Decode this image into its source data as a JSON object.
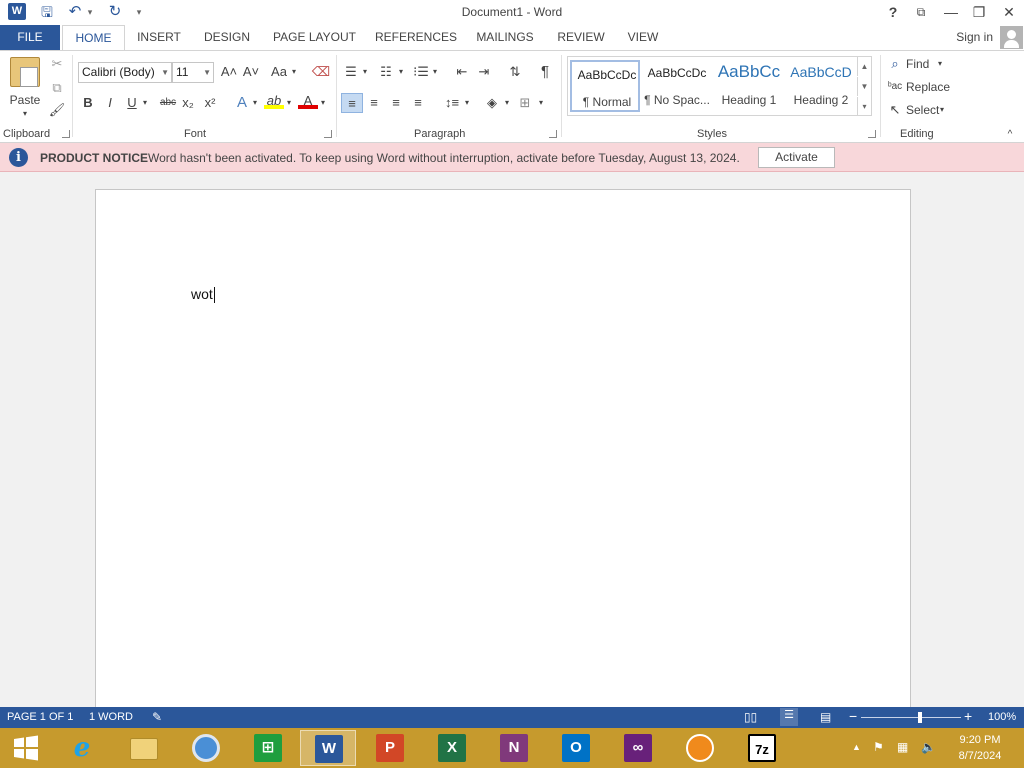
{
  "window": {
    "title": "Document1 - Word",
    "help": "?",
    "ribbon_display": "⧉",
    "minimize": "—",
    "restore": "❐",
    "close": "✕"
  },
  "qat": {
    "app_icon": "W",
    "save": "🖫",
    "undo": "↶",
    "undo_dd": "▾",
    "redo": "↻",
    "customize": "▾"
  },
  "tabs": [
    {
      "label": "FILE"
    },
    {
      "label": "HOME"
    },
    {
      "label": "INSERT"
    },
    {
      "label": "DESIGN"
    },
    {
      "label": "PAGE LAYOUT"
    },
    {
      "label": "REFERENCES"
    },
    {
      "label": "MAILINGS"
    },
    {
      "label": "REVIEW"
    },
    {
      "label": "VIEW"
    }
  ],
  "signin": "Sign in",
  "clipboard": {
    "paste": "Paste",
    "paste_dd": "▾",
    "cut": "✂",
    "copy": "⧉",
    "format_painter": "🖌",
    "label": "Clipboard"
  },
  "font": {
    "name": "Calibri (Body)",
    "size": "11",
    "grow": "A˄",
    "shrink": "A˅",
    "case": "Aa",
    "clear": "⌫",
    "bold": "B",
    "italic": "I",
    "underline": "U",
    "strike": "abc",
    "sub": "x₂",
    "sup": "x²",
    "effects": "A",
    "highlight": "ab",
    "color": "A",
    "label": "Font"
  },
  "paragraph": {
    "bullets": "☰",
    "numbering": "☷",
    "multilevel": "⁝☰",
    "decrease_indent": "⇤",
    "increase_indent": "⇥",
    "sort": "⇅",
    "pilcrow": "¶",
    "align_left": "≡",
    "center": "≡",
    "align_right": "≡",
    "justify": "≡",
    "spacing": "↕≡",
    "shading": "◈",
    "borders": "⊞",
    "label": "Paragraph"
  },
  "styles": {
    "items": [
      {
        "sample": "AaBbCcDc",
        "name": "¶ Normal"
      },
      {
        "sample": "AaBbCcDc",
        "name": "¶ No Spac..."
      },
      {
        "sample": "AaBbCc",
        "name": "Heading 1"
      },
      {
        "sample": "AaBbCcD",
        "name": "Heading 2"
      }
    ],
    "label": "Styles"
  },
  "editing": {
    "find": "Find",
    "replace": "Replace",
    "select": "Select",
    "label": "Editing"
  },
  "notice": {
    "title": "PRODUCT NOTICE",
    "text": "Word hasn't been activated. To keep using Word without interruption, activate before Tuesday, August 13, 2024.",
    "button": "Activate"
  },
  "document": {
    "text": "wot"
  },
  "status": {
    "page": "PAGE 1 OF 1",
    "words": "1 WORD",
    "zoom": "100%",
    "zoom_level": 1.0
  },
  "taskbar": {
    "time": "9:20 PM",
    "date": "8/7/2024"
  },
  "colors": {
    "word_blue": "#2b579a",
    "taskbar": "#c69a2d",
    "notice_bg": "#f8d7da"
  }
}
